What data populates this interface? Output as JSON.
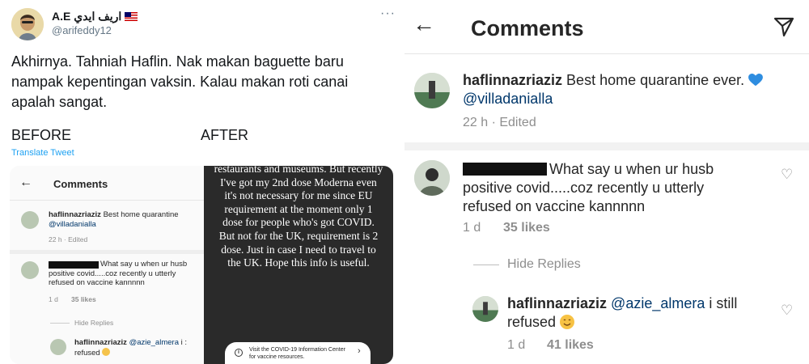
{
  "tweet": {
    "display_name": "A.E اريف ايدي",
    "handle": "@arifeddy12",
    "more": "···",
    "text": "Akhirnya. Tahniah Haflin. Nak makan baguette baru nampak kepentingan vaksin. Kalau makan roti canai apalah sangat.",
    "before_label": "BEFORE",
    "after_label": "AFTER",
    "translate": "Translate Tweet"
  },
  "mini": {
    "back": "←",
    "title": "Comments",
    "c1_user": "haflinnazriaziz",
    "c1_text": "Best home quarantine",
    "c1_mention": "@villadanialla",
    "c1_meta": "22 h · Edited",
    "c2_text1": "What say u when ur husb",
    "c2_text2": "positive covid.....coz recently u utterly",
    "c2_text3": "refused on vaccine kannnnn",
    "c2_time": "1 d",
    "c2_likes": "35 likes",
    "hide": "Hide Replies",
    "c3_user": "haflinnazriaziz",
    "c3_mention": "@azie_almera",
    "c3_tail": "i :",
    "c3_text": "refused"
  },
  "story": {
    "text": "restaurants and museums. But recently I've got my 2nd dose Moderna even it's not necessary for me since EU requirement at the moment only 1 dose for people who's got COVID. But not for the UK, requirement is 2 dose. Just in case I need to travel to the UK. Hope this info is useful.",
    "pill_icon": "i",
    "pill_text": "Visit the COVID-19 Information Center for vaccine resources.",
    "pill_arrow": "›"
  },
  "ig": {
    "back": "←",
    "title": "Comments",
    "c1": {
      "user": "haflinnazriaziz",
      "text": "Best home quarantine ever.",
      "mention": "@villadanialla",
      "meta": "22 h · Edited"
    },
    "c2": {
      "line1": "What say u when ur husb",
      "line2": "positive covid.....coz recently u utterly",
      "line3": "refused on vaccine kannnnn",
      "time": "1 d",
      "likes": "35 likes"
    },
    "hide_replies": "Hide Replies",
    "c3": {
      "user": "haflinnazriaziz",
      "mention": "@azie_almera",
      "text": "i still",
      "text2": "refused",
      "time": "1 d",
      "likes": "41 likes"
    },
    "heart": "♡"
  },
  "colors": {
    "twitter_blue": "#1da1f2",
    "ig_mention": "#00376b",
    "heart_blue": "#2e8de0"
  }
}
